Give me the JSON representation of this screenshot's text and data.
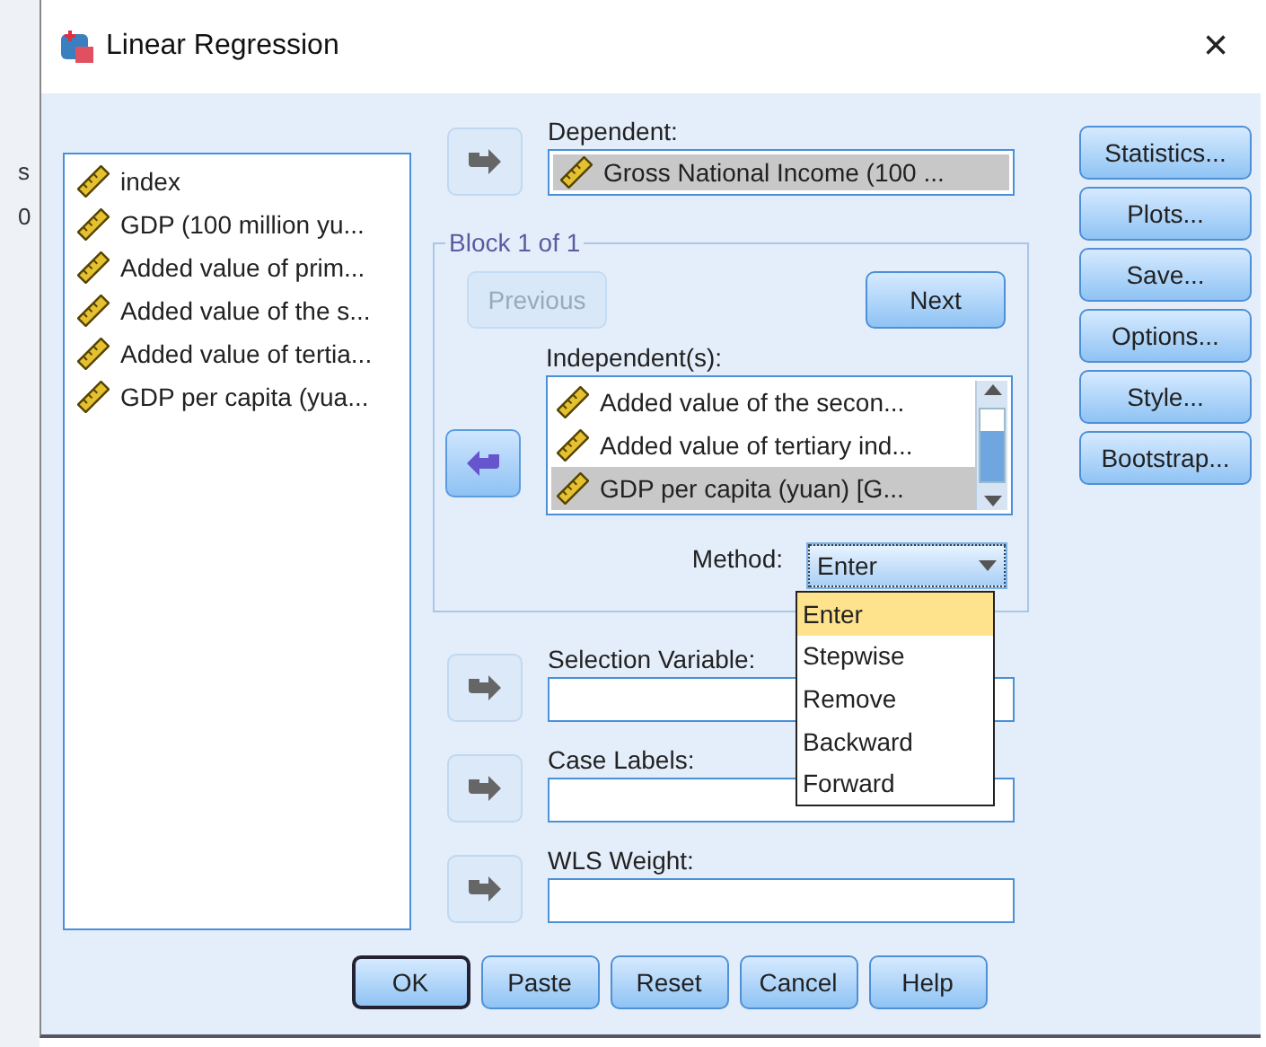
{
  "background_cells": [
    "s",
    "0"
  ],
  "window": {
    "title": "Linear Regression",
    "close": "×"
  },
  "source_variables": [
    {
      "label": "index",
      "selected": false
    },
    {
      "label": "GDP (100 million yu...",
      "selected": false
    },
    {
      "label": "Added value of prim...",
      "selected": false
    },
    {
      "label": "Added value of the s...",
      "selected": false
    },
    {
      "label": "Added value of tertia...",
      "selected": false
    },
    {
      "label": "GDP per capita (yua...",
      "selected": false
    }
  ],
  "dependent": {
    "label": "Dependent:",
    "value": "Gross National Income (100 ..."
  },
  "block": {
    "title": "Block 1 of 1",
    "previous": {
      "label": "Previous",
      "disabled": true
    },
    "next": {
      "label": "Next",
      "disabled": false
    }
  },
  "independents": {
    "label": "Independent(s):",
    "items": [
      {
        "label": "Added value of the secon...",
        "selected": false
      },
      {
        "label": "Added value of tertiary ind...",
        "selected": false
      },
      {
        "label": "GDP per capita (yuan) [G...",
        "selected": true
      }
    ]
  },
  "method": {
    "label": "Method:",
    "value": "Enter",
    "expanded": true,
    "options": [
      {
        "label": "Enter",
        "selected": true
      },
      {
        "label": "Stepwise",
        "selected": false
      },
      {
        "label": "Remove",
        "selected": false
      },
      {
        "label": "Backward",
        "selected": false
      },
      {
        "label": "Forward",
        "selected": false
      }
    ]
  },
  "selection_variable": {
    "label": "Selection Variable:"
  },
  "case_labels": {
    "label": "Case Labels:"
  },
  "wls_weight": {
    "label": "WLS Weight:"
  },
  "side_buttons": [
    "Statistics...",
    "Plots...",
    "Save...",
    "Options...",
    "Style...",
    "Bootstrap..."
  ],
  "bottom_buttons": [
    {
      "label": "OK",
      "default": true
    },
    {
      "label": "Paste",
      "default": false
    },
    {
      "label": "Reset",
      "default": false
    },
    {
      "label": "Cancel",
      "default": false
    },
    {
      "label": "Help",
      "default": false
    }
  ]
}
